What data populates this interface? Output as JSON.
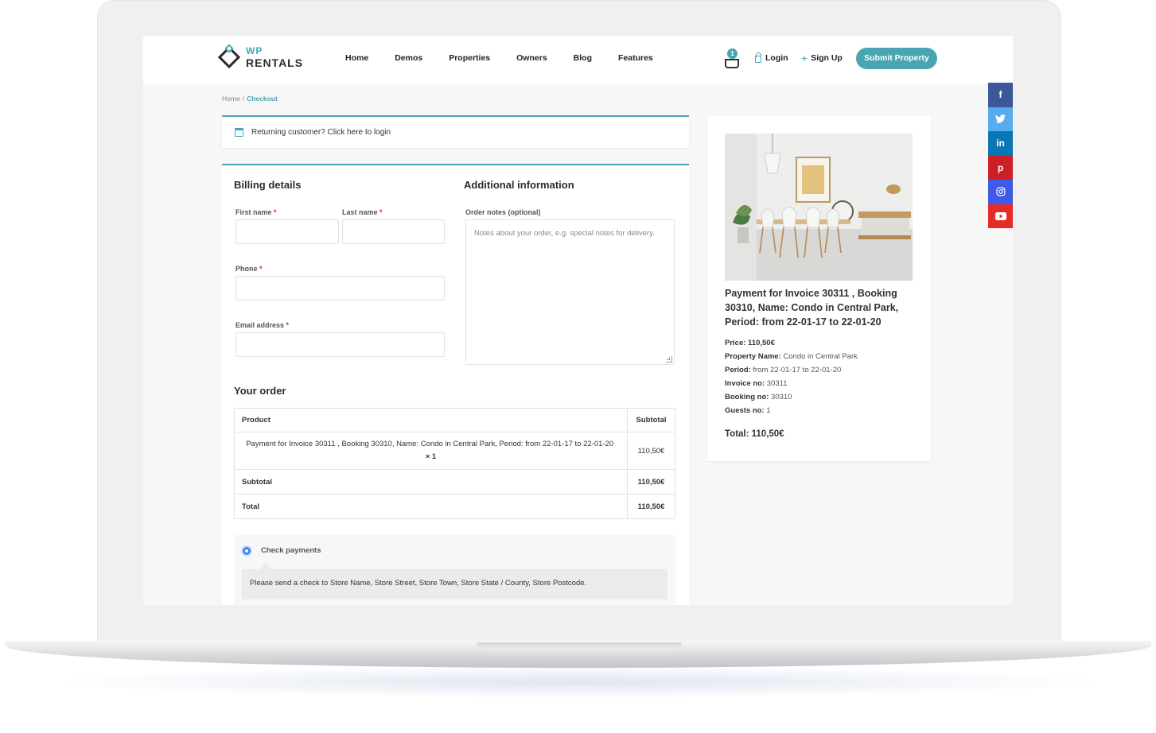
{
  "header": {
    "logo_wp": "WP",
    "logo_rentals": "RENTALS",
    "nav": [
      "Home",
      "Demos",
      "Properties",
      "Owners",
      "Blog",
      "Features"
    ],
    "cart_count": "1",
    "login": "Login",
    "signup": "Sign Up",
    "submit": "Submit Property"
  },
  "social": [
    {
      "name": "facebook",
      "glyph": "f",
      "color": "#3b5998"
    },
    {
      "name": "twitter",
      "glyph": "t",
      "color": "#55acee"
    },
    {
      "name": "linkedin",
      "glyph": "in",
      "color": "#0a77b5"
    },
    {
      "name": "pinterest",
      "glyph": "p",
      "color": "#cb2027"
    },
    {
      "name": "instagram",
      "glyph": "◎",
      "color": "#3d5ae8"
    },
    {
      "name": "youtube",
      "glyph": "▶",
      "color": "#e52d27"
    }
  ],
  "breadcrumb": {
    "home": "Home",
    "sep": "/",
    "current": "Checkout"
  },
  "returning": "Returning customer? Click here to login",
  "billing": {
    "title": "Billing details",
    "first_name": "First name",
    "last_name": "Last name",
    "phone": "Phone",
    "email": "Email address",
    "required": "*"
  },
  "additional": {
    "title": "Additional information",
    "notes_label": "Order notes (optional)",
    "notes_placeholder": "Notes about your order, e.g. special notes for delivery."
  },
  "order": {
    "title": "Your order",
    "col_product": "Product",
    "col_subtotal": "Subtotal",
    "item": "Payment for Invoice 30311 , Booking 30310, Name: Condo in Central Park, Period: from 22-01-17 to 22-01-20",
    "item_qty": "× 1",
    "item_price": "110,50€",
    "subtotal_label": "Subtotal",
    "subtotal_value": "110,50€",
    "total_label": "Total",
    "total_value": "110,50€"
  },
  "payment": {
    "method": "Check payments",
    "instructions": "Please send a check to Store Name, Store Street, Store Town, Store State / County, Store Postcode."
  },
  "summary": {
    "title": "Payment for Invoice 30311 , Booking 30310, Name: Condo in Central Park, Period: from 22-01-17 to 22-01-20",
    "price_label": "Price:",
    "price": "110,50€",
    "property_label": "Property Name:",
    "property": "Condo in Central Park",
    "period_label": "Period:",
    "period": "from 22-01-17 to 22-01-20",
    "invoice_label": "Invoice no:",
    "invoice": "30311",
    "booking_label": "Booking no:",
    "booking": "30310",
    "guests_label": "Guests no:",
    "guests": "1",
    "total": "Total: 110,50€"
  }
}
